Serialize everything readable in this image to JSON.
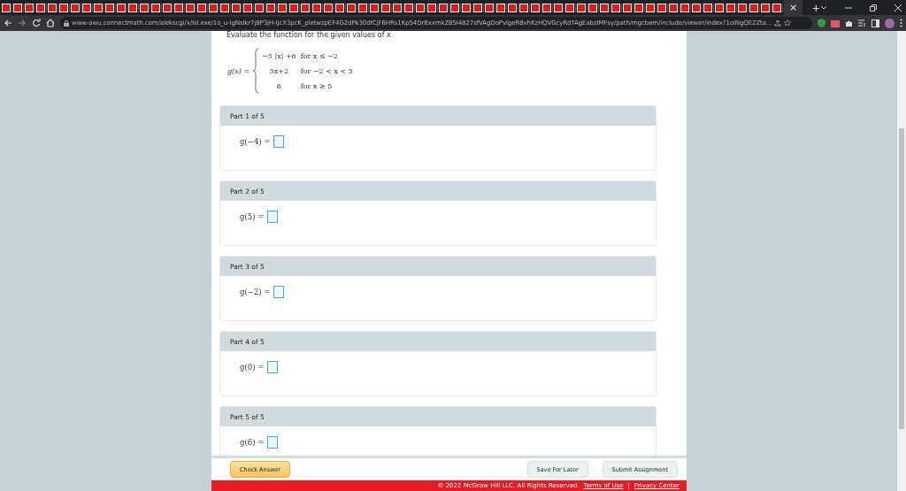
{
  "browser": {
    "url": "www-awu.connectmath.com/alekscgi/x/Isl.exe/1o_u-IgNslkr7j8P3jH-IJcX3pcK_pletwzpEF4G2dPk30dfCjF6HRs1Kp54Dr8xxmkZ85I4827sfVAgDoPvlgeR8vhKzHQVGcyRdTAgEabzIMFsy/path/mgcbem/include/viewer/index?1oiNgQE2Zta...",
    "new_tab": "+",
    "tab_close": "×"
  },
  "question": {
    "instruction": "Evaluate the function for the given values of *x*.",
    "function_name": "g(x) =",
    "cases": [
      {
        "expression": "−5 |x| +6",
        "condition": "for x ≤ −2"
      },
      {
        "expression": "5x+2",
        "condition": "for −2 < x < 5"
      },
      {
        "expression": "6",
        "condition": "for x ≥ 5"
      }
    ]
  },
  "parts": [
    {
      "label": "Part 1 of 5",
      "prompt": "g(−4) ="
    },
    {
      "label": "Part 2 of 5",
      "prompt": "g(5) ="
    },
    {
      "label": "Part 3 of 5",
      "prompt": "g(−2) ="
    },
    {
      "label": "Part 4 of 5",
      "prompt": "g(0) ="
    },
    {
      "label": "Part 5 of 5",
      "prompt": "g(6) ="
    }
  ],
  "actions": {
    "check": "Check Answer",
    "save": "Save For Later",
    "submit": "Submit Assignment"
  },
  "footer": {
    "copyright": "© 2022 McGraw Hill LLC. All Rights Reserved.",
    "links": [
      "Terms of Use",
      "Privacy Center"
    ],
    "separator": "|"
  }
}
